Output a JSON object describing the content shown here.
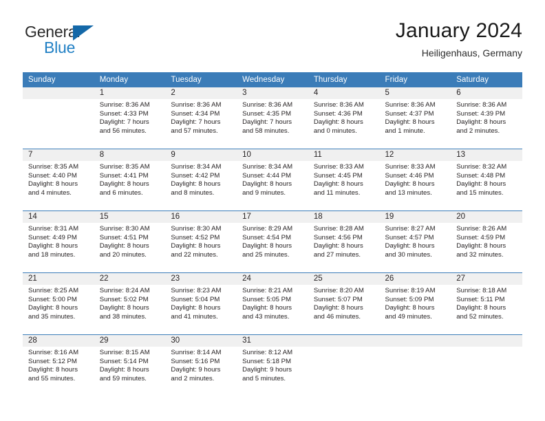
{
  "brand": {
    "name_top": "General",
    "name_bottom": "Blue",
    "colors": {
      "text": "#2b2b2b",
      "accent": "#1f7fc4",
      "triangle": "#1468a8"
    }
  },
  "header": {
    "title": "January 2024",
    "subtitle": "Heiligenhaus, Germany"
  },
  "theme": {
    "header_row_bg": "#3b7cb8",
    "day_band_bg": "#f0f0f0",
    "grid_line": "#3b7cb8",
    "text": "#231f20"
  },
  "weekday_headers": [
    "Sunday",
    "Monday",
    "Tuesday",
    "Wednesday",
    "Thursday",
    "Friday",
    "Saturday"
  ],
  "weeks": [
    [
      {
        "blank": true
      },
      {
        "day": "1",
        "sunrise": "Sunrise: 8:36 AM",
        "sunset": "Sunset: 4:33 PM",
        "daylight1": "Daylight: 7 hours",
        "daylight2": "and 56 minutes."
      },
      {
        "day": "2",
        "sunrise": "Sunrise: 8:36 AM",
        "sunset": "Sunset: 4:34 PM",
        "daylight1": "Daylight: 7 hours",
        "daylight2": "and 57 minutes."
      },
      {
        "day": "3",
        "sunrise": "Sunrise: 8:36 AM",
        "sunset": "Sunset: 4:35 PM",
        "daylight1": "Daylight: 7 hours",
        "daylight2": "and 58 minutes."
      },
      {
        "day": "4",
        "sunrise": "Sunrise: 8:36 AM",
        "sunset": "Sunset: 4:36 PM",
        "daylight1": "Daylight: 8 hours",
        "daylight2": "and 0 minutes."
      },
      {
        "day": "5",
        "sunrise": "Sunrise: 8:36 AM",
        "sunset": "Sunset: 4:37 PM",
        "daylight1": "Daylight: 8 hours",
        "daylight2": "and 1 minute."
      },
      {
        "day": "6",
        "sunrise": "Sunrise: 8:36 AM",
        "sunset": "Sunset: 4:39 PM",
        "daylight1": "Daylight: 8 hours",
        "daylight2": "and 2 minutes."
      }
    ],
    [
      {
        "day": "7",
        "sunrise": "Sunrise: 8:35 AM",
        "sunset": "Sunset: 4:40 PM",
        "daylight1": "Daylight: 8 hours",
        "daylight2": "and 4 minutes."
      },
      {
        "day": "8",
        "sunrise": "Sunrise: 8:35 AM",
        "sunset": "Sunset: 4:41 PM",
        "daylight1": "Daylight: 8 hours",
        "daylight2": "and 6 minutes."
      },
      {
        "day": "9",
        "sunrise": "Sunrise: 8:34 AM",
        "sunset": "Sunset: 4:42 PM",
        "daylight1": "Daylight: 8 hours",
        "daylight2": "and 8 minutes."
      },
      {
        "day": "10",
        "sunrise": "Sunrise: 8:34 AM",
        "sunset": "Sunset: 4:44 PM",
        "daylight1": "Daylight: 8 hours",
        "daylight2": "and 9 minutes."
      },
      {
        "day": "11",
        "sunrise": "Sunrise: 8:33 AM",
        "sunset": "Sunset: 4:45 PM",
        "daylight1": "Daylight: 8 hours",
        "daylight2": "and 11 minutes."
      },
      {
        "day": "12",
        "sunrise": "Sunrise: 8:33 AM",
        "sunset": "Sunset: 4:46 PM",
        "daylight1": "Daylight: 8 hours",
        "daylight2": "and 13 minutes."
      },
      {
        "day": "13",
        "sunrise": "Sunrise: 8:32 AM",
        "sunset": "Sunset: 4:48 PM",
        "daylight1": "Daylight: 8 hours",
        "daylight2": "and 15 minutes."
      }
    ],
    [
      {
        "day": "14",
        "sunrise": "Sunrise: 8:31 AM",
        "sunset": "Sunset: 4:49 PM",
        "daylight1": "Daylight: 8 hours",
        "daylight2": "and 18 minutes."
      },
      {
        "day": "15",
        "sunrise": "Sunrise: 8:30 AM",
        "sunset": "Sunset: 4:51 PM",
        "daylight1": "Daylight: 8 hours",
        "daylight2": "and 20 minutes."
      },
      {
        "day": "16",
        "sunrise": "Sunrise: 8:30 AM",
        "sunset": "Sunset: 4:52 PM",
        "daylight1": "Daylight: 8 hours",
        "daylight2": "and 22 minutes."
      },
      {
        "day": "17",
        "sunrise": "Sunrise: 8:29 AM",
        "sunset": "Sunset: 4:54 PM",
        "daylight1": "Daylight: 8 hours",
        "daylight2": "and 25 minutes."
      },
      {
        "day": "18",
        "sunrise": "Sunrise: 8:28 AM",
        "sunset": "Sunset: 4:56 PM",
        "daylight1": "Daylight: 8 hours",
        "daylight2": "and 27 minutes."
      },
      {
        "day": "19",
        "sunrise": "Sunrise: 8:27 AM",
        "sunset": "Sunset: 4:57 PM",
        "daylight1": "Daylight: 8 hours",
        "daylight2": "and 30 minutes."
      },
      {
        "day": "20",
        "sunrise": "Sunrise: 8:26 AM",
        "sunset": "Sunset: 4:59 PM",
        "daylight1": "Daylight: 8 hours",
        "daylight2": "and 32 minutes."
      }
    ],
    [
      {
        "day": "21",
        "sunrise": "Sunrise: 8:25 AM",
        "sunset": "Sunset: 5:00 PM",
        "daylight1": "Daylight: 8 hours",
        "daylight2": "and 35 minutes."
      },
      {
        "day": "22",
        "sunrise": "Sunrise: 8:24 AM",
        "sunset": "Sunset: 5:02 PM",
        "daylight1": "Daylight: 8 hours",
        "daylight2": "and 38 minutes."
      },
      {
        "day": "23",
        "sunrise": "Sunrise: 8:23 AM",
        "sunset": "Sunset: 5:04 PM",
        "daylight1": "Daylight: 8 hours",
        "daylight2": "and 41 minutes."
      },
      {
        "day": "24",
        "sunrise": "Sunrise: 8:21 AM",
        "sunset": "Sunset: 5:05 PM",
        "daylight1": "Daylight: 8 hours",
        "daylight2": "and 43 minutes."
      },
      {
        "day": "25",
        "sunrise": "Sunrise: 8:20 AM",
        "sunset": "Sunset: 5:07 PM",
        "daylight1": "Daylight: 8 hours",
        "daylight2": "and 46 minutes."
      },
      {
        "day": "26",
        "sunrise": "Sunrise: 8:19 AM",
        "sunset": "Sunset: 5:09 PM",
        "daylight1": "Daylight: 8 hours",
        "daylight2": "and 49 minutes."
      },
      {
        "day": "27",
        "sunrise": "Sunrise: 8:18 AM",
        "sunset": "Sunset: 5:11 PM",
        "daylight1": "Daylight: 8 hours",
        "daylight2": "and 52 minutes."
      }
    ],
    [
      {
        "day": "28",
        "sunrise": "Sunrise: 8:16 AM",
        "sunset": "Sunset: 5:12 PM",
        "daylight1": "Daylight: 8 hours",
        "daylight2": "and 55 minutes."
      },
      {
        "day": "29",
        "sunrise": "Sunrise: 8:15 AM",
        "sunset": "Sunset: 5:14 PM",
        "daylight1": "Daylight: 8 hours",
        "daylight2": "and 59 minutes."
      },
      {
        "day": "30",
        "sunrise": "Sunrise: 8:14 AM",
        "sunset": "Sunset: 5:16 PM",
        "daylight1": "Daylight: 9 hours",
        "daylight2": "and 2 minutes."
      },
      {
        "day": "31",
        "sunrise": "Sunrise: 8:12 AM",
        "sunset": "Sunset: 5:18 PM",
        "daylight1": "Daylight: 9 hours",
        "daylight2": "and 5 minutes."
      },
      {
        "blank": true
      },
      {
        "blank": true
      },
      {
        "blank": true
      }
    ]
  ]
}
